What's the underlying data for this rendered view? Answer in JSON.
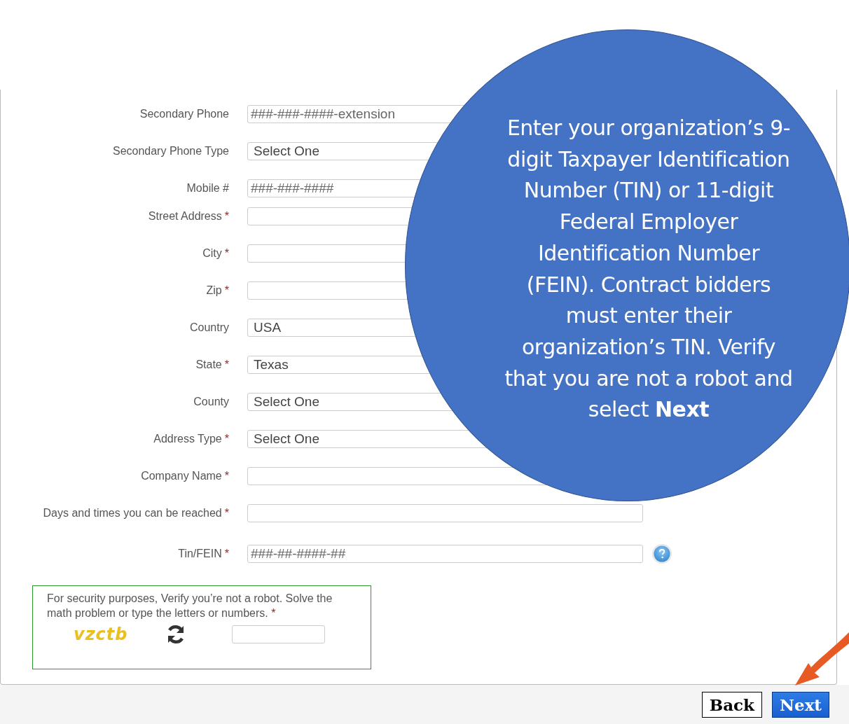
{
  "form": {
    "fields": [
      {
        "label": "Secondary Phone",
        "kind": "text",
        "placeholder": "###-###-####-extension"
      },
      {
        "label": "Secondary Phone Type",
        "kind": "select",
        "value": "Select One"
      },
      {
        "label": "Mobile #",
        "kind": "text",
        "placeholder": "###-###-####"
      },
      {
        "label": "Street Address",
        "required_mark": "*",
        "kind": "text"
      },
      {
        "label": "City",
        "required_mark": "*",
        "kind": "text"
      },
      {
        "label": "Zip",
        "required_mark": "*",
        "kind": "text"
      },
      {
        "label": "Country",
        "kind": "select",
        "value": "USA"
      },
      {
        "label": "State",
        "required_mark": "*",
        "kind": "select",
        "value": "Texas"
      },
      {
        "label": "County",
        "kind": "select",
        "value": "Select One"
      },
      {
        "label": "Address Type",
        "required_mark": "*",
        "kind": "select",
        "value": "Select One"
      },
      {
        "label": "Company Name",
        "required_mark": "*",
        "kind": "text"
      },
      {
        "label": "Days and times you can be reached",
        "required_mark": "*",
        "kind": "text"
      },
      {
        "label": "Tin/FEIN",
        "required_mark": "*",
        "kind": "text",
        "placeholder": "###-##-####-##",
        "help": true
      }
    ],
    "captcha": {
      "prompt": "For security purposes, Verify you’re not a robot. Solve the math problem or type the letters or numbers.",
      "required_mark": "*",
      "image_text": "vzctb"
    }
  },
  "buttons": [
    {
      "label": "Back",
      "kind": "secondary"
    },
    {
      "label": "Next",
      "kind": "primary"
    }
  ],
  "callout": {
    "text": "Enter your organization’s 9-digit Taxpayer Identification Number (TIN) or 11-digit Federal Employer Identification Number (FEIN). Contract bidders must enter their organization’s TIN. Verify that you are not a robot and select **Next**"
  }
}
